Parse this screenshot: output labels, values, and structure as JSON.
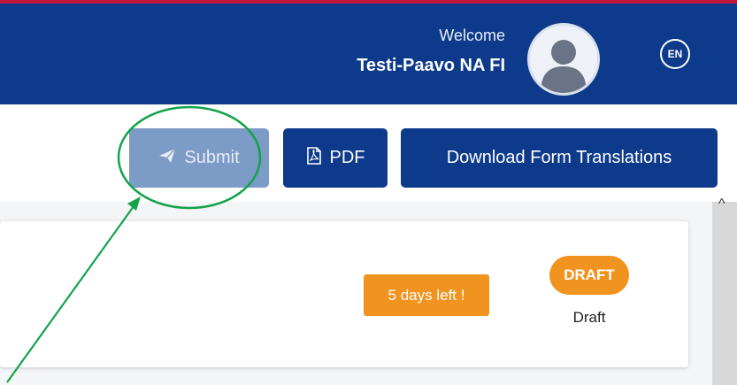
{
  "header": {
    "welcome_label": "Welcome",
    "user_name": "Testi-Paavo NA FI",
    "language_code": "EN"
  },
  "toolbar": {
    "submit_label": "Submit",
    "pdf_label": "PDF",
    "download_translations_label": "Download Form Translations"
  },
  "form_card": {
    "deadline_badge": "5 days left !",
    "status_badge": "DRAFT",
    "status_text": "Draft"
  },
  "icons": {
    "submit": "paper-plane-icon",
    "pdf": "pdf-file-icon",
    "language": "language-chat-icon",
    "avatar": "user-avatar-icon"
  },
  "colors": {
    "header_bg": "#0d3a8a",
    "header_top_border": "#c0183a",
    "button_primary": "#0d3a8a",
    "button_disabled": "#7d9bc7",
    "badge_orange": "#f0931f",
    "annotation_green": "#13a34a"
  }
}
